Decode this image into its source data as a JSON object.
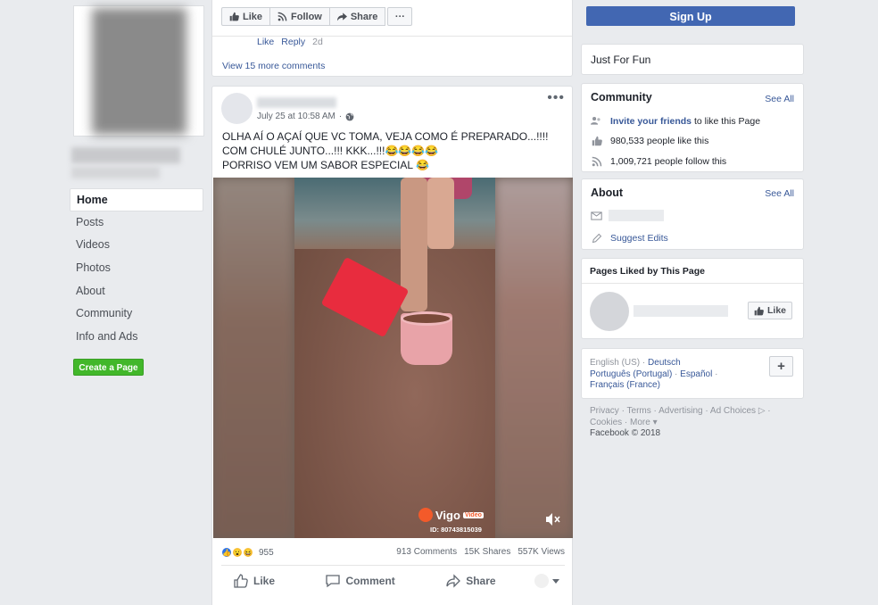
{
  "left": {
    "nav": [
      "Home",
      "Posts",
      "Videos",
      "Photos",
      "About",
      "Community",
      "Info and Ads"
    ],
    "create_page": "Create a Page"
  },
  "top_card": {
    "toolbar": {
      "like": "Like",
      "follow": "Follow",
      "share": "Share",
      "more": "···"
    },
    "comment_actions": {
      "like": "Like",
      "reply": "Reply",
      "time": "2d"
    },
    "view_more": "View 15 more comments"
  },
  "post": {
    "time": "July 25 at 10:58 AM",
    "dot": "·",
    "options": "•••",
    "text_line1": "OLHA AÍ O AÇAÍ QUE VC TOMA, VEJA COMO É PREPARADO...!!!! COM CHULÉ JUNTO...!!! KKK...!!!😂😂😂😂",
    "text_line2": "PORRISO VEM UM SABOR ESPECIAL 😂",
    "video": {
      "logo": "Vigo",
      "logo_tag": "Video",
      "id": "ID: 80743815039"
    },
    "reactions_count": "955",
    "comments": "913 Comments",
    "shares": "15K Shares",
    "views": "557K Views",
    "actions": {
      "like": "Like",
      "comment": "Comment",
      "share": "Share"
    }
  },
  "right": {
    "signup": "Sign Up",
    "category": "Just For Fun",
    "community": {
      "title": "Community",
      "see_all": "See All",
      "invite_link": "Invite your friends",
      "invite_rest": " to like this Page",
      "likes": "980,533 people like this",
      "follows": "1,009,721 people follow this"
    },
    "about": {
      "title": "About",
      "see_all": "See All",
      "suggest": "Suggest Edits"
    },
    "pages_liked": {
      "title": "Pages Liked by This Page",
      "like": "Like"
    },
    "languages": {
      "current": "English (US)",
      "lang2": "Deutsch",
      "lang3": "Português (Portugal)",
      "lang4": "Español",
      "lang5": "Français (France)",
      "add": "+"
    },
    "footer": {
      "privacy": "Privacy",
      "terms": "Terms",
      "advertising": "Advertising",
      "ad_choices": "Ad Choices",
      "cookies": "Cookies",
      "more": "More",
      "copyright": "Facebook © 2018"
    }
  },
  "colors": {
    "brand": "#4267b2",
    "link": "#385898",
    "green": "#42b72a",
    "background": "#e9ebee"
  }
}
